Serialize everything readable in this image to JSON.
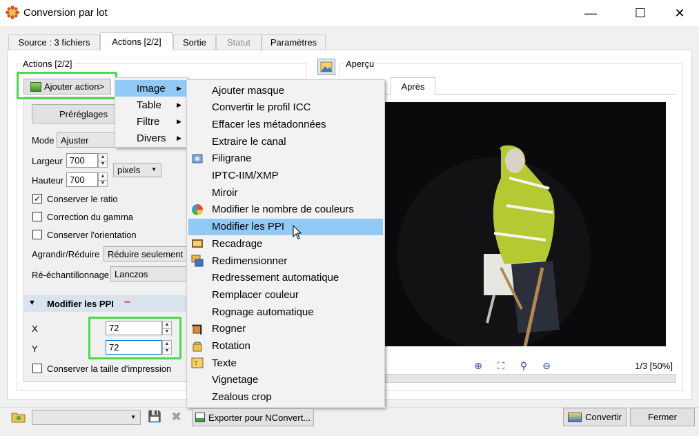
{
  "window": {
    "title": "Conversion par lot",
    "minimize": "—",
    "maximize": "☐",
    "close": "✕"
  },
  "tabs": [
    {
      "label": "Source : 3 fichiers",
      "state": "normal"
    },
    {
      "label": "Actions [2/2]",
      "state": "active"
    },
    {
      "label": "Sortie",
      "state": "normal"
    },
    {
      "label": "Statut",
      "state": "disabled"
    },
    {
      "label": "Paramètres",
      "state": "normal"
    }
  ],
  "actions": {
    "group_label": "Actions [2/2]",
    "add_action_button": "Ajouter action>",
    "presets_label": "Préréglages",
    "mode_label": "Mode",
    "mode_value": "Ajuster",
    "width_label": "Largeur",
    "width_value": "700",
    "height_label": "Hauteur",
    "height_value": "700",
    "unit_value": "pixels",
    "keep_ratio": {
      "label": "Conserver le ratio",
      "checked": true,
      "mark": "✓"
    },
    "gamma": {
      "label": "Correction du gamma",
      "checked": false
    },
    "orientation": {
      "label": "Conserver l'orientation",
      "checked": false
    },
    "enlarge_label": "Agrandir/Réduire",
    "enlarge_value": "Réduire seulement",
    "resample_label": "Ré-échantillonnage",
    "resample_value": "Lanczos",
    "ppi_section": {
      "title": "Modifier les PPI",
      "collapse_glyph": "▼",
      "remove_glyph": "−"
    },
    "x_label": "X",
    "x_value": "72",
    "y_label": "Y",
    "y_value": "72",
    "keep_print_size": {
      "label": "Conserver la taille d'impression",
      "checked": false
    }
  },
  "preview": {
    "group_label": "Aperçu",
    "tab_after": "Après",
    "page_info": "1/3 [50%]"
  },
  "category_menu": [
    {
      "label": "Image",
      "arrow": "▶",
      "selected": true
    },
    {
      "label": "Table",
      "arrow": "▶",
      "selected": false
    },
    {
      "label": "Filtre",
      "arrow": "▶",
      "selected": false
    },
    {
      "label": "Divers",
      "arrow": "▶",
      "selected": false
    }
  ],
  "image_menu": [
    {
      "label": "Ajouter masque",
      "icon": ""
    },
    {
      "label": "Convertir le profil ICC",
      "icon": ""
    },
    {
      "label": "Effacer les métadonnées",
      "icon": ""
    },
    {
      "label": "Extraire le canal",
      "icon": ""
    },
    {
      "label": "Filigrane",
      "icon": "watermark-icon"
    },
    {
      "label": "IPTC-IIM/XMP",
      "icon": ""
    },
    {
      "label": "Miroir",
      "icon": ""
    },
    {
      "label": "Modifier le nombre de couleurs",
      "icon": "colors-icon"
    },
    {
      "label": "Modifier les PPI",
      "icon": "",
      "selected": true
    },
    {
      "label": "Recadrage",
      "icon": "canvas-icon"
    },
    {
      "label": "Redimensionner",
      "icon": "resize-icon"
    },
    {
      "label": "Redressement automatique",
      "icon": ""
    },
    {
      "label": "Remplacer couleur",
      "icon": ""
    },
    {
      "label": "Rognage automatique",
      "icon": ""
    },
    {
      "label": "Rogner",
      "icon": "crop-icon"
    },
    {
      "label": "Rotation",
      "icon": "rotate-icon"
    },
    {
      "label": "Texte",
      "icon": "text-icon"
    },
    {
      "label": "Vignetage",
      "icon": ""
    },
    {
      "label": "Zealous crop",
      "icon": ""
    }
  ],
  "bottom": {
    "export_button": "Exporter pour NConvert...",
    "convert_button": "Convertir",
    "close_button": "Fermer"
  },
  "colors": {
    "highlight_green": "#4cd84c",
    "menu_selection": "#91c9f7",
    "focus_blue": "#0078d7"
  }
}
